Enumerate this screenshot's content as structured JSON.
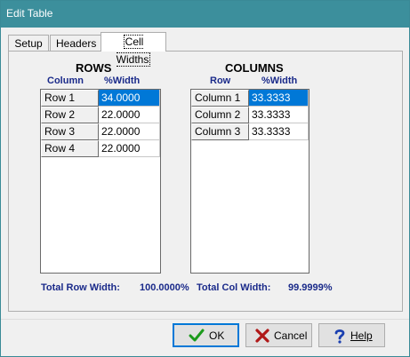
{
  "window": {
    "title": "Edit Table"
  },
  "tabs": [
    {
      "label": "Setup"
    },
    {
      "label": "Headers"
    },
    {
      "label": "Cell Widths"
    }
  ],
  "rows_section": {
    "title": "ROWS",
    "col1_header": "Column",
    "col2_header": "%Width",
    "items": [
      {
        "label": "Row 1",
        "value": "34.0000"
      },
      {
        "label": "Row 2",
        "value": "22.0000"
      },
      {
        "label": "Row 3",
        "value": "22.0000"
      },
      {
        "label": "Row 4",
        "value": "22.0000"
      }
    ]
  },
  "columns_section": {
    "title": "COLUMNS",
    "col1_header": "Row",
    "col2_header": "%Width",
    "items": [
      {
        "label": "Column 1",
        "value": "33.3333"
      },
      {
        "label": "Column 2",
        "value": "33.3333"
      },
      {
        "label": "Column 3",
        "value": "33.3333"
      }
    ]
  },
  "totals": {
    "row_label": "Total Row Width:",
    "row_value": "100.0000%",
    "col_label": "Total Col Width:",
    "col_value": "99.9999%"
  },
  "buttons": {
    "ok": "OK",
    "cancel": "Cancel",
    "help": "Help"
  },
  "colors": {
    "titlebar": "#3c8f9c",
    "selection": "#0078d7",
    "header_text": "#1a2a8a",
    "ok_icon": "#1c9a1c",
    "cancel_icon": "#b01818",
    "help_icon": "#1a3fb0"
  },
  "icons": {
    "ok": "checkmark-icon",
    "cancel": "x-icon",
    "help": "question-mark-icon"
  }
}
